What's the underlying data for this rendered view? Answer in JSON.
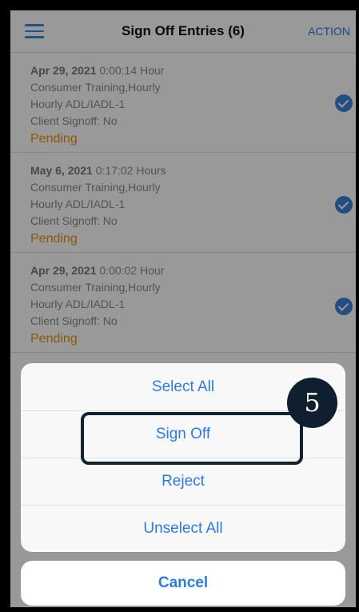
{
  "header": {
    "title": "Sign Off Entries (6)",
    "action_label": "ACTION"
  },
  "entries": [
    {
      "date": "Apr 29, 2021",
      "duration": " 0:00:14 Hour",
      "service": "Consumer Training,Hourly",
      "code": "Hourly ADL/IADL-1",
      "client_signoff": "Client Signoff: No",
      "status": "Pending"
    },
    {
      "date": "May 6, 2021",
      "duration": " 0:17:02 Hours",
      "service": "Consumer Training,Hourly",
      "code": "Hourly ADL/IADL-1",
      "client_signoff": "Client Signoff: No",
      "status": "Pending"
    },
    {
      "date": "Apr 29, 2021",
      "duration": " 0:00:02 Hour",
      "service": "Consumer Training,Hourly",
      "code": "Hourly ADL/IADL-1",
      "client_signoff": "Client Signoff: No",
      "status": "Pending"
    }
  ],
  "action_sheet": {
    "select_all": "Select All",
    "sign_off": "Sign Off",
    "reject": "Reject",
    "unselect_all": "Unselect All",
    "cancel": "Cancel"
  },
  "annotation": {
    "step_number": "5"
  },
  "colors": {
    "accent": "#2e7be0",
    "pending": "#e8930f",
    "check": "#3c80dc"
  }
}
